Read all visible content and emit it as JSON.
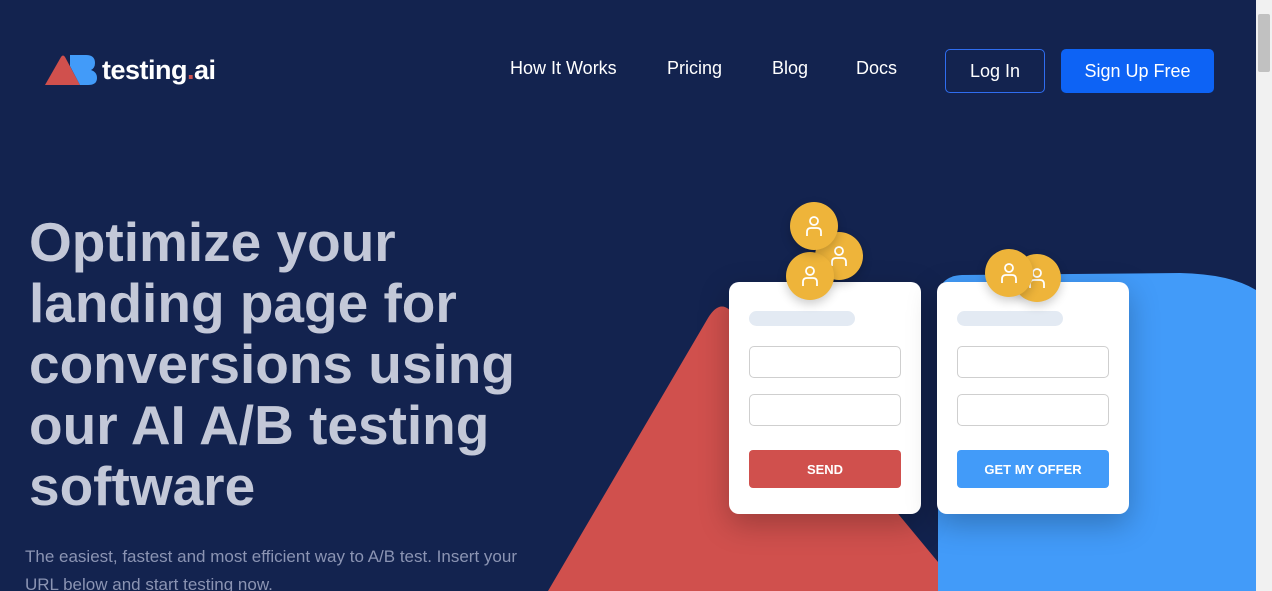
{
  "logo": {
    "text_main": "testing",
    "text_dot": ".",
    "text_suffix": "ai"
  },
  "nav": {
    "items": [
      "How It Works",
      "Pricing",
      "Blog",
      "Docs"
    ],
    "login": "Log In",
    "signup": "Sign Up Free"
  },
  "hero": {
    "title": "Optimize your landing page for conversions using our AI A/B testing software",
    "subtitle": "The easiest, fastest and most efficient way to A/B test. Insert your URL below and start testing now."
  },
  "variants": [
    {
      "button": "SEND",
      "color": "#d0504d"
    },
    {
      "button": "GET MY OFFER",
      "color": "#429bf9"
    }
  ],
  "colors": {
    "background": "#13234f",
    "accent": "#0d63f5",
    "red": "#d0504d",
    "blue": "#429bf9",
    "avatar": "#eeb43a"
  }
}
